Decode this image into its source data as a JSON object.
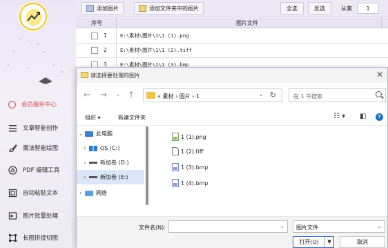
{
  "sidebar": {
    "items": [
      {
        "label": "会员服务中心",
        "icon": "user-icon",
        "active": true
      },
      {
        "label": "文章智能创作",
        "icon": "list-icon"
      },
      {
        "label": "魔法智能绘图",
        "icon": "brush-icon"
      },
      {
        "label": "PDF 编辑工具",
        "icon": "pdf-icon"
      },
      {
        "label": "自动粘贴文本",
        "icon": "paste-icon"
      },
      {
        "label": "图片批量处理",
        "icon": "image-batch-icon"
      },
      {
        "label": "长图拼接切图",
        "icon": "crop-icon"
      }
    ],
    "active_color": "#d24b4b"
  },
  "toolbar": {
    "add_image": "添加图片",
    "add_folder_images": "添加文件夹中的图片",
    "select_all": "全选",
    "invert": "反选",
    "from_label": "从第",
    "from_value": "1"
  },
  "table": {
    "col_no": "序号",
    "col_file": "图片文件",
    "rows": [
      {
        "no": "1",
        "path": "E:\\素材\\图片\\1\\1 (1).png"
      },
      {
        "no": "2",
        "path": "E:\\素材\\图片\\1\\1 (2).tiff"
      },
      {
        "no": "3",
        "path": "E:\\素材\\图片\\1\\1 (3).bmp"
      }
    ]
  },
  "dialog": {
    "title": "请选择要处理的图片",
    "address": "« 素材 › 图片 › 1",
    "search_placeholder": "在 1 中搜索",
    "organize": "组织 ▾",
    "new_folder": "新建文件夹",
    "tree": [
      {
        "label": "此电脑",
        "chev": "⌄",
        "icon": "computer-icon"
      },
      {
        "label": "OS (C:)",
        "chev": "›",
        "icon": "drive-icon"
      },
      {
        "label": "新加卷 (D:)",
        "chev": "›",
        "icon": "drive-icon"
      },
      {
        "label": "新加卷 (E:)",
        "chev": "›",
        "icon": "drive-icon",
        "selected": true
      },
      {
        "label": "网络",
        "chev": "›",
        "icon": "network-icon"
      }
    ],
    "files": [
      {
        "name": "1 (1).png",
        "icon": "png-file-icon"
      },
      {
        "name": "1 (2).tiff",
        "icon": "tiff-file-icon"
      },
      {
        "name": "1 (3).bmp",
        "icon": "bmp-file-icon"
      },
      {
        "name": "1 (4).bmp",
        "icon": "bmp-file-icon"
      }
    ],
    "filename_label": "文件名(N):",
    "filename_value": "",
    "filetype": "图片文件",
    "open": "打开(O)",
    "cancel": "取消"
  },
  "colors": {
    "accent": "#2b63b5",
    "sidebar_bg": "#ebe6f7",
    "selection": "#dbe7f8"
  }
}
